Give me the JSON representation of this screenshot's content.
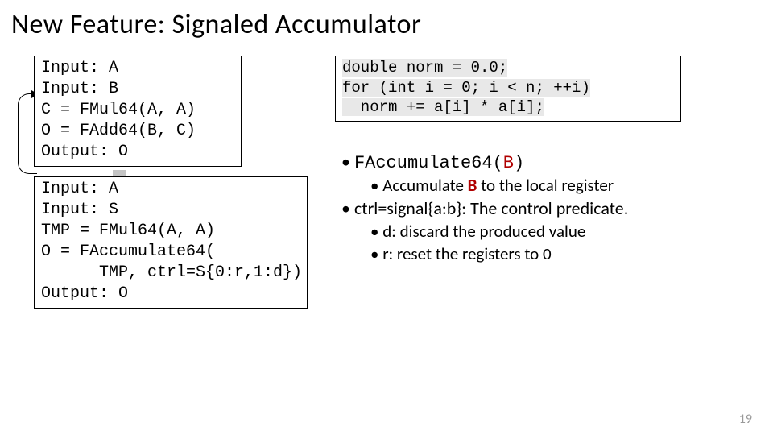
{
  "title": "New Feature: Signaled Accumulator",
  "code1": {
    "l1": "Input: A",
    "l2": "Input: B",
    "l3": "C = FMul64(A, A)",
    "l4": "O = FAdd64(B, C)",
    "l5": "Output: O"
  },
  "code2": {
    "l1": "Input: A",
    "l2": "Input: S",
    "l3": "TMP = FMul64(A, A)",
    "l4": "O = FAccumulate64(",
    "l5": "      TMP, ctrl=S{0:r,1:d})",
    "l6": "Output: O"
  },
  "cpp": {
    "l1": "double norm = 0.0;",
    "l2": "for (int i = 0; i < n; ++i)",
    "l3": "  norm += a[i] * a[i];"
  },
  "bullets": {
    "b1_pre": "FAccumulate64(",
    "b1_arg": "B",
    "b1_post": ")",
    "b1a_pre": "Accumulate ",
    "b1a_mid": "B",
    "b1a_post": " to the local register",
    "b2": "ctrl=signal{a:b}: The control predicate.",
    "b2a": "d: discard the produced value",
    "b2b": "r: reset the registers to 0"
  },
  "pagenum": "19"
}
